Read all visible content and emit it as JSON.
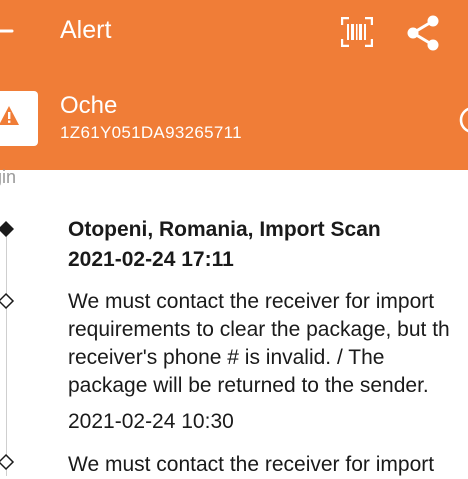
{
  "appbar": {
    "title": "Alert",
    "background": "#F07D37",
    "icons": [
      "back-arrow-icon",
      "barcode-scan-icon",
      "share-icon"
    ]
  },
  "package": {
    "name": "Oche",
    "tracking_number": "1Z61Y051DA93265711",
    "status_icon": "warning-icon",
    "info_icon": "info-icon"
  },
  "timeline": {
    "section_label": "igin",
    "events": [
      {
        "location": "Otopeni, Romania, Import Scan",
        "time": "2021-02-24 17:11"
      },
      {
        "description": "We must contact the receiver for import\nrequirements to clear the package, but th\nreceiver's phone # is invalid. / The\npackage will be returned to the sender.",
        "time": "2021-02-24 10:30"
      },
      {
        "description": "We must contact the receiver for import"
      }
    ]
  }
}
